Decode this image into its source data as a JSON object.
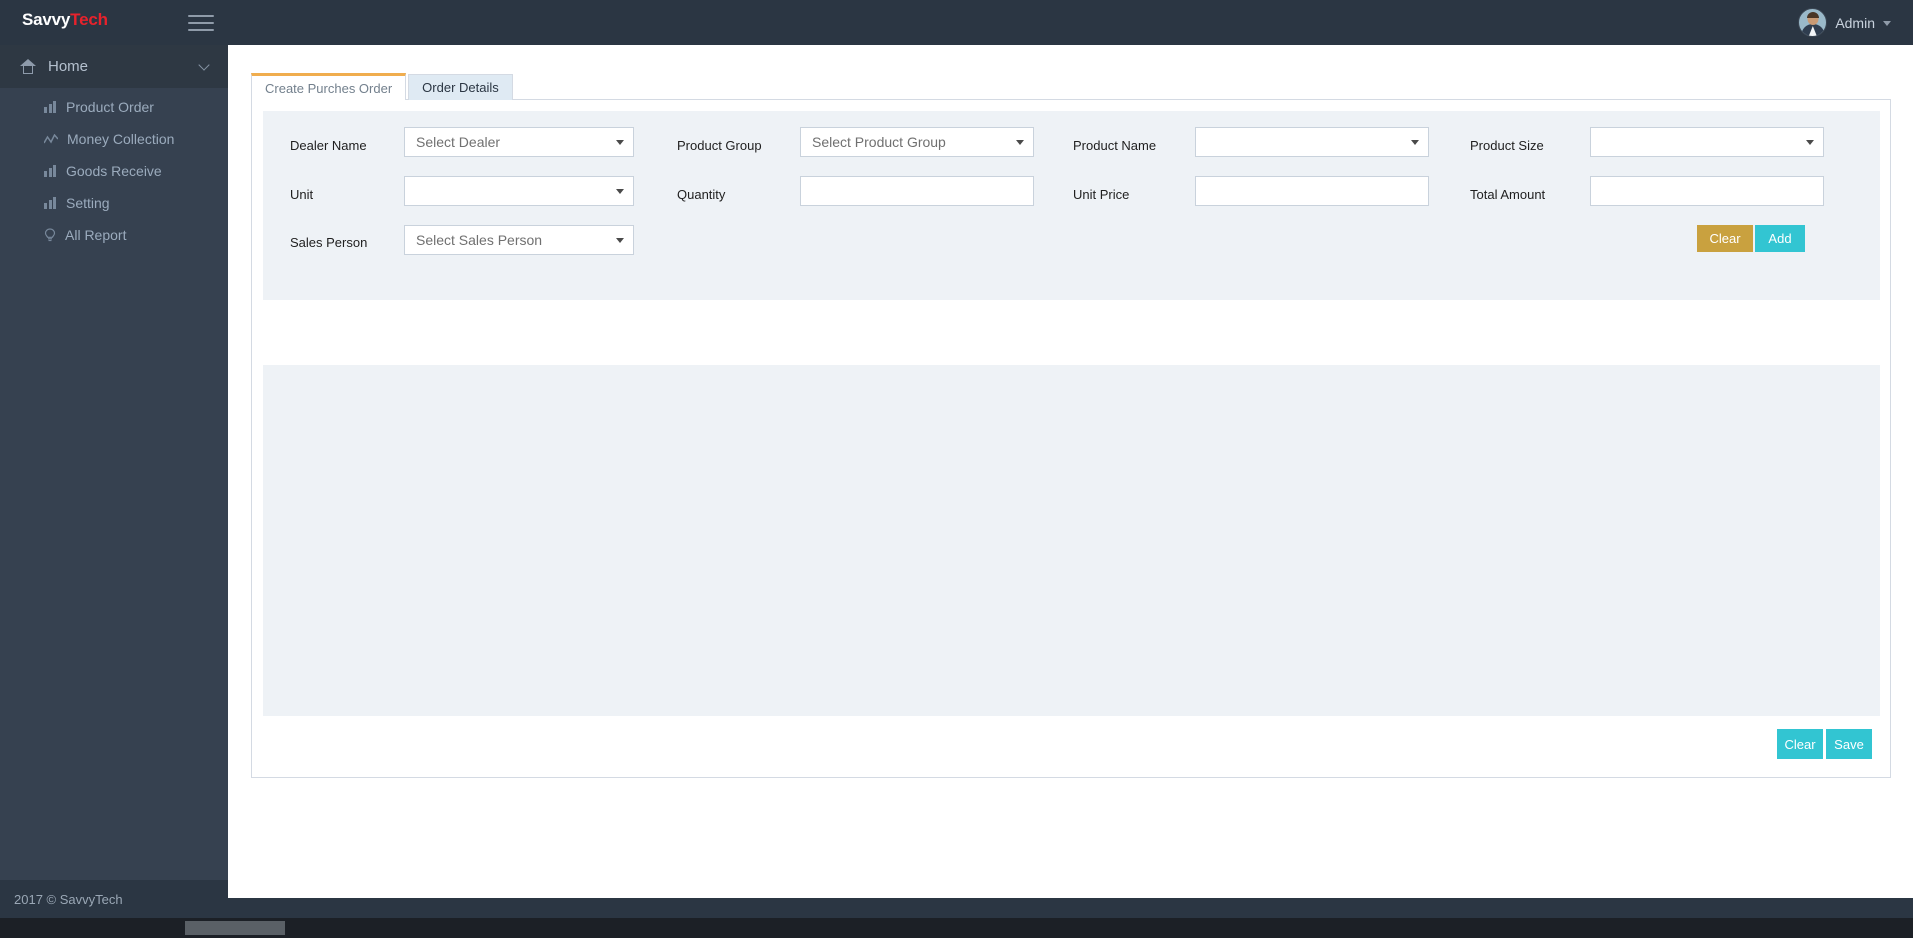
{
  "header": {
    "brand_primary": "Savvy",
    "brand_accent": "Tech",
    "brand_accent_color": "#e7222c",
    "menu_toggle": "hamburger-menu",
    "user_name": "Admin"
  },
  "sidebar": {
    "home": {
      "label": "Home",
      "icon": "home-icon",
      "expanded": true
    },
    "items": [
      {
        "label": "Product Order",
        "icon": "bar-chart-icon"
      },
      {
        "label": "Money Collection",
        "icon": "line-chart-icon"
      },
      {
        "label": "Goods Receive",
        "icon": "bar-chart-icon"
      },
      {
        "label": "Setting",
        "icon": "bar-chart-icon"
      },
      {
        "label": "All Report",
        "icon": "lightbulb-icon"
      }
    ]
  },
  "tabs": [
    {
      "label": "Create Purches Order",
      "active": true
    },
    {
      "label": "Order Details",
      "active": false
    }
  ],
  "form": {
    "fields": [
      {
        "label": "Dealer Name",
        "type": "select",
        "value": "Select Dealer",
        "name": "dealer-name"
      },
      {
        "label": "Product Group",
        "type": "select",
        "value": "Select Product Group",
        "name": "product-group"
      },
      {
        "label": "Product Name",
        "type": "select",
        "value": "",
        "name": "product-name"
      },
      {
        "label": "Product Size",
        "type": "select",
        "value": "",
        "name": "product-size"
      },
      {
        "label": "Unit",
        "type": "select",
        "value": "",
        "name": "unit"
      },
      {
        "label": "Quantity",
        "type": "text",
        "value": "",
        "name": "quantity"
      },
      {
        "label": "Unit Price",
        "type": "text",
        "value": "",
        "name": "unit-price"
      },
      {
        "label": "Total Amount",
        "type": "text",
        "value": "",
        "name": "total-amount"
      },
      {
        "label": "Sales Person",
        "type": "select",
        "value": "Select Sales Person",
        "name": "sales-person"
      }
    ],
    "clear_label": "Clear",
    "add_label": "Add"
  },
  "footer_actions": {
    "clear_label": "Clear",
    "save_label": "Save"
  },
  "footer": {
    "copyright": "2017 © SavvyTech"
  },
  "colors": {
    "topbar": "#2b3643",
    "sidebar": "#364150",
    "accent_cyan": "#32c5d2",
    "accent_gold": "#c9a13f",
    "tab_active_border": "#f0ad4e",
    "panel_inner": "#eef2f6"
  }
}
